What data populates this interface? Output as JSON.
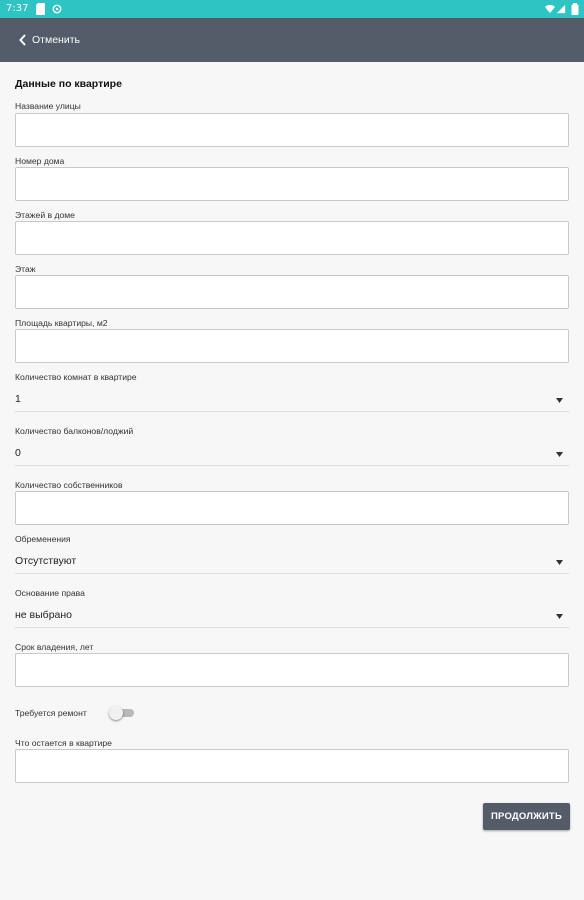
{
  "status_bar": {
    "time": "7:37",
    "icons": [
      "sd-card-icon",
      "sync-icon",
      "wifi-icon",
      "signal-icon",
      "battery-icon"
    ],
    "color": "#2ec4c4"
  },
  "app_bar": {
    "cancel_label": "Отменить",
    "color": "#535c68"
  },
  "form": {
    "title": "Данные по квартире",
    "street": {
      "label": "Название улицы",
      "value": ""
    },
    "house_number": {
      "label": "Номер дома",
      "value": ""
    },
    "floors_in_house": {
      "label": "Этажей в доме",
      "value": ""
    },
    "floor": {
      "label": "Этаж",
      "value": ""
    },
    "area": {
      "label": "Площадь квартиры, м2",
      "value": ""
    },
    "rooms": {
      "label": "Количество комнат в квартире",
      "value": "1"
    },
    "balconies": {
      "label": "Количество балконов/лоджий",
      "value": "0"
    },
    "owners": {
      "label": "Количество собственников",
      "value": ""
    },
    "encumbrances": {
      "label": "Обременения",
      "value": "Отсутствуют"
    },
    "ownership_basis": {
      "label": "Основание права",
      "value": "не выбрано"
    },
    "ownership_term": {
      "label": "Срок владения, лет",
      "value": ""
    },
    "repair_needed": {
      "label": "Требуется ремонт",
      "checked": false
    },
    "remaining_items": {
      "label": "Что остается в квартире",
      "value": ""
    }
  },
  "continue_label": "ПРОДОЛЖИТЬ"
}
